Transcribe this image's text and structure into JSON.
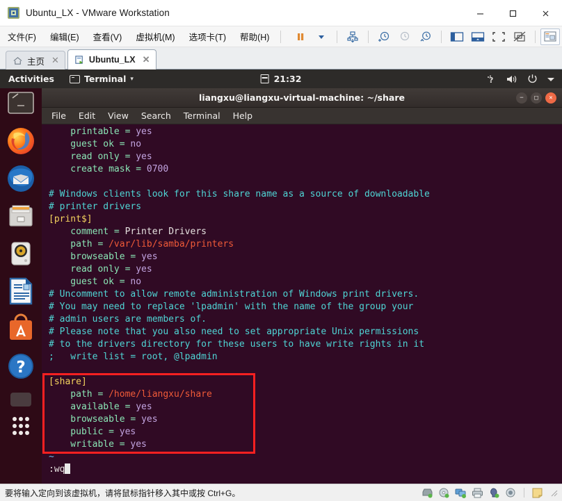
{
  "vmware": {
    "window_title": "Ubuntu_LX - VMware Workstation",
    "app_icon": "vmware-icon",
    "window_buttons": [
      {
        "name": "minimize-button",
        "glyph": "─"
      },
      {
        "name": "maximize-button",
        "glyph": "□"
      },
      {
        "name": "close-button",
        "glyph": "✕"
      }
    ],
    "menus": [
      {
        "label": "文件(F)",
        "name": "menu-file"
      },
      {
        "label": "编辑(E)",
        "name": "menu-edit"
      },
      {
        "label": "查看(V)",
        "name": "menu-view"
      },
      {
        "label": "虚拟机(M)",
        "name": "menu-vm"
      },
      {
        "label": "选项卡(T)",
        "name": "menu-tabs"
      },
      {
        "label": "帮助(H)",
        "name": "menu-help"
      }
    ],
    "toolbar_icons": [
      "pause-button",
      "dropdown-caret",
      "snapshot-manager-button",
      "take-snapshot-button",
      "revert-snapshot-button",
      "manage-snapshots-button",
      "show-library-button",
      "show-thumbnails-button",
      "fullscreen-button",
      "unity-mode-button",
      "console-view-button"
    ],
    "tabs": [
      {
        "label": "主页",
        "name": "tab-home",
        "icon": "home-icon",
        "active": false
      },
      {
        "label": "Ubuntu_LX",
        "name": "tab-ubuntu-lx",
        "icon": "vm-icon",
        "active": true
      }
    ],
    "tab_close_glyph": "✕",
    "status_text": "要将输入定向到该虚拟机，请将鼠标指针移入其中或按 Ctrl+G。",
    "status_icons": [
      "hard-disk-icon",
      "cd-dvd-icon",
      "network-adapter-icon",
      "printer-icon",
      "usb-icon",
      "camera-icon",
      "note-icon"
    ]
  },
  "ubuntu": {
    "panel": {
      "activities": "Activities",
      "app_name": "Terminal",
      "app_caret": "▾",
      "clock": "21:32",
      "calendar_icon": "calendar-icon",
      "tray_icons": [
        "keyboard-input-icon",
        "volume-icon",
        "power-icon",
        "system-menu-caret"
      ]
    },
    "dock_items": [
      {
        "name": "dock-item-files-manager",
        "icon": "screen-icon"
      },
      {
        "name": "dock-item-firefox",
        "icon": "firefox-icon"
      },
      {
        "name": "dock-item-thunderbird",
        "icon": "thunderbird-icon"
      },
      {
        "name": "dock-item-files",
        "icon": "file-cabinet-icon"
      },
      {
        "name": "dock-item-rhythmbox",
        "icon": "rhythmbox-icon"
      },
      {
        "name": "dock-item-libreoffice-writer",
        "icon": "document-icon"
      },
      {
        "name": "dock-item-ubuntu-software",
        "icon": "software-bag-icon"
      },
      {
        "name": "dock-item-help",
        "icon": "question-mark-icon"
      },
      {
        "name": "dock-item-trash",
        "icon": "trash-icon"
      },
      {
        "name": "dock-item-show-applications",
        "icon": "grid-dots-icon"
      }
    ]
  },
  "terminal": {
    "title": "liangxu@liangxu-virtual-machine: ~/share",
    "window_buttons": [
      {
        "name": "terminal-minimize-button",
        "glyph": "−"
      },
      {
        "name": "terminal-maximize-button",
        "glyph": "□"
      },
      {
        "name": "terminal-close-button",
        "glyph": "✕"
      }
    ],
    "menus": [
      "File",
      "Edit",
      "View",
      "Search",
      "Terminal",
      "Help"
    ],
    "lines": [
      [
        {
          "t": "    printable = ",
          "c": "c-key"
        },
        {
          "t": "yes",
          "c": "c-val"
        }
      ],
      [
        {
          "t": "    guest ok = ",
          "c": "c-key"
        },
        {
          "t": "no",
          "c": "c-val"
        }
      ],
      [
        {
          "t": "    read only = ",
          "c": "c-key"
        },
        {
          "t": "yes",
          "c": "c-val"
        }
      ],
      [
        {
          "t": "    create mask = ",
          "c": "c-key"
        },
        {
          "t": "0700",
          "c": "c-val"
        }
      ],
      [
        {
          "t": "",
          "c": "c-plain"
        }
      ],
      [
        {
          "t": "# Windows clients look for this share name as a source of downloadable",
          "c": "c-comment"
        }
      ],
      [
        {
          "t": "# printer drivers",
          "c": "c-comment"
        }
      ],
      [
        {
          "t": "[print$]",
          "c": "c-sect"
        }
      ],
      [
        {
          "t": "    comment = ",
          "c": "c-key"
        },
        {
          "t": "Printer Drivers",
          "c": "c-plain"
        }
      ],
      [
        {
          "t": "    path = ",
          "c": "c-key"
        },
        {
          "t": "/var/lib/samba/printers",
          "c": "c-path"
        }
      ],
      [
        {
          "t": "    browseable = ",
          "c": "c-key"
        },
        {
          "t": "yes",
          "c": "c-val"
        }
      ],
      [
        {
          "t": "    read only = ",
          "c": "c-key"
        },
        {
          "t": "yes",
          "c": "c-val"
        }
      ],
      [
        {
          "t": "    guest ok = ",
          "c": "c-key"
        },
        {
          "t": "no",
          "c": "c-val"
        }
      ],
      [
        {
          "t": "# Uncomment to allow remote administration of Windows print drivers.",
          "c": "c-comment"
        }
      ],
      [
        {
          "t": "# You may need to replace 'lpadmin' with the name of the group your",
          "c": "c-comment"
        }
      ],
      [
        {
          "t": "# admin users are members of.",
          "c": "c-comment"
        }
      ],
      [
        {
          "t": "# Please note that you also need to set appropriate Unix permissions",
          "c": "c-comment"
        }
      ],
      [
        {
          "t": "# to the drivers directory for these users to have write rights in it",
          "c": "c-comment"
        }
      ],
      [
        {
          "t": ";   write list = root, @lpadmin",
          "c": "c-comment"
        }
      ],
      [
        {
          "t": "",
          "c": "c-plain"
        }
      ],
      [
        {
          "t": "[share]",
          "c": "c-sect"
        }
      ],
      [
        {
          "t": "    path = ",
          "c": "c-key"
        },
        {
          "t": "/home/liangxu/share",
          "c": "c-path"
        }
      ],
      [
        {
          "t": "    available = ",
          "c": "c-key"
        },
        {
          "t": "yes",
          "c": "c-val"
        }
      ],
      [
        {
          "t": "    browseable = ",
          "c": "c-key"
        },
        {
          "t": "yes",
          "c": "c-val"
        }
      ],
      [
        {
          "t": "    public = ",
          "c": "c-key"
        },
        {
          "t": "yes",
          "c": "c-val"
        }
      ],
      [
        {
          "t": "    writable = ",
          "c": "c-key"
        },
        {
          "t": "yes",
          "c": "c-val"
        }
      ],
      [
        {
          "t": "~",
          "c": "c-tilde"
        }
      ],
      [
        {
          "t": ":wq",
          "c": "c-plain",
          "cursor": true
        }
      ]
    ],
    "annotation": {
      "name": "share-section-highlight",
      "color": "#f92020"
    }
  }
}
